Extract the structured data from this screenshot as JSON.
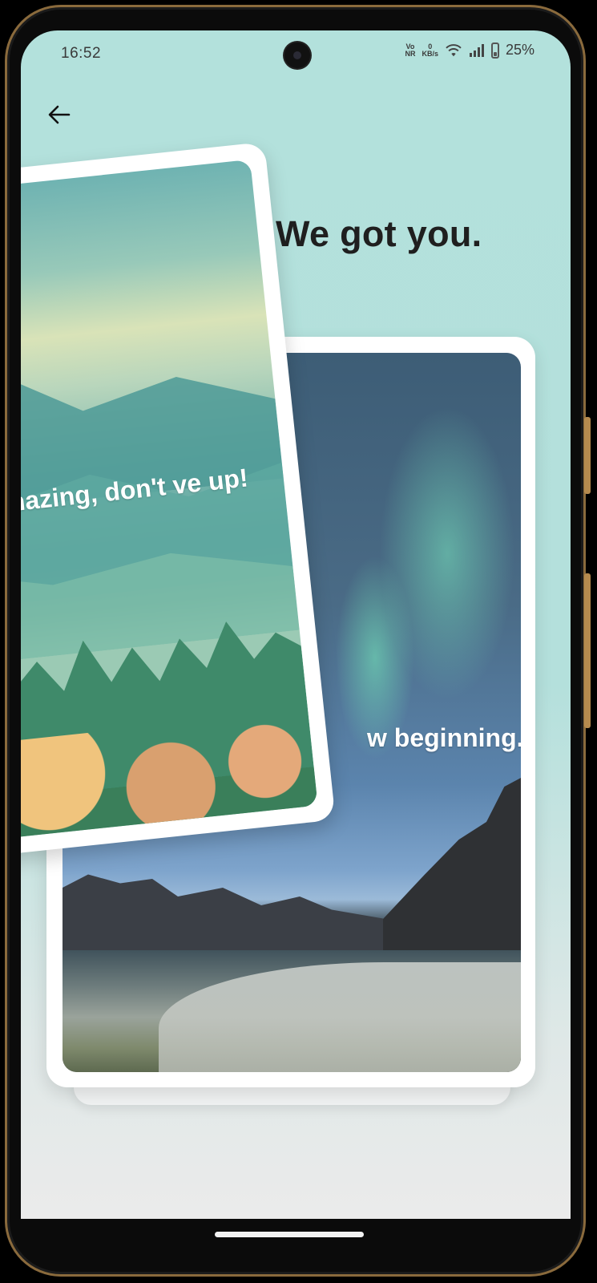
{
  "status_bar": {
    "time": "16:52",
    "network_line1": "Vo",
    "network_line2": "NR",
    "speed_line1": "0",
    "speed_line2": "KB/s",
    "battery": "25%"
  },
  "header": {
    "back_icon": "arrow-left-icon",
    "headline": "We got you."
  },
  "cards": [
    {
      "text": "amazing, don't ve up!",
      "image": "forest-mountains-illustration"
    },
    {
      "text": "w beginning.",
      "image": "aurora-night-beach"
    }
  ],
  "colors": {
    "background": "#b3e1dc",
    "headline": "#1f1f1f",
    "card_border": "#ffffff"
  }
}
